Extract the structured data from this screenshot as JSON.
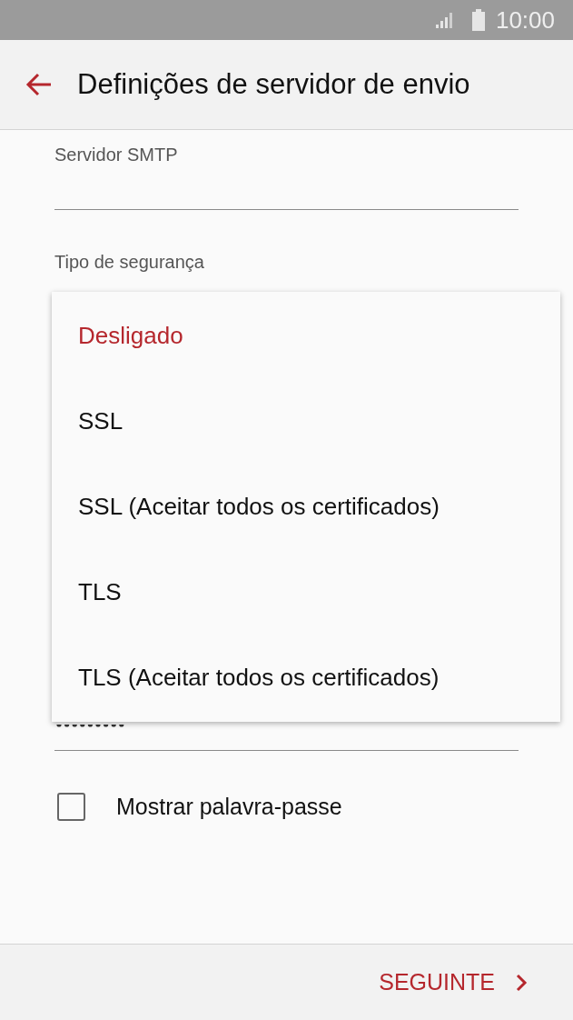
{
  "status_bar": {
    "time": "10:00"
  },
  "header": {
    "title": "Definições de servidor de envio"
  },
  "fields": [
    {
      "label": "Servidor SMTP"
    },
    {
      "label": "Tipo de segurança"
    }
  ],
  "dropdown": {
    "options": [
      {
        "label": "Desligado",
        "selected": true
      },
      {
        "label": "SSL",
        "selected": false
      },
      {
        "label": "SSL (Aceitar todos os certificados)",
        "selected": false
      },
      {
        "label": "TLS",
        "selected": false
      },
      {
        "label": "TLS (Aceitar todos os certificados)",
        "selected": false
      }
    ]
  },
  "show_password": {
    "label": "Mostrar palavra-passe",
    "checked": false
  },
  "footer": {
    "next_label": "SEGUINTE"
  }
}
